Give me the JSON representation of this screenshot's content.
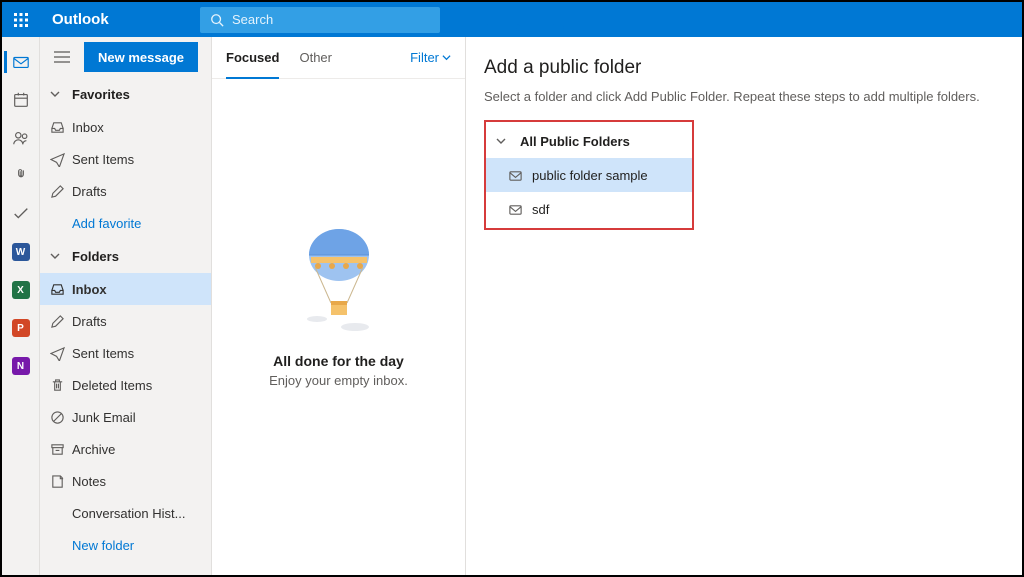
{
  "brand": "Outlook",
  "search": {
    "placeholder": "Search"
  },
  "new_message_label": "New message",
  "sections": {
    "favorites": {
      "label": "Favorites",
      "items": [
        {
          "icon": "tray",
          "label": "Inbox"
        },
        {
          "icon": "send",
          "label": "Sent Items"
        },
        {
          "icon": "pencil",
          "label": "Drafts"
        }
      ],
      "add_label": "Add favorite"
    },
    "folders": {
      "label": "Folders",
      "items": [
        {
          "icon": "tray-full",
          "label": "Inbox",
          "selected": true
        },
        {
          "icon": "pencil",
          "label": "Drafts"
        },
        {
          "icon": "send",
          "label": "Sent Items"
        },
        {
          "icon": "trash",
          "label": "Deleted Items"
        },
        {
          "icon": "block",
          "label": "Junk Email"
        },
        {
          "icon": "archive",
          "label": "Archive"
        },
        {
          "icon": "note",
          "label": "Notes"
        },
        {
          "icon": "",
          "label": "Conversation Hist..."
        }
      ],
      "new_label": "New folder"
    }
  },
  "tabs": {
    "focused": "Focused",
    "other": "Other",
    "filter": "Filter"
  },
  "empty_state": {
    "headline": "All done for the day",
    "sub": "Enjoy your empty inbox."
  },
  "panel": {
    "add_link": "Add Public Folder",
    "title": "Add a public folder",
    "desc": "Select a folder and click Add Public Folder. Repeat these steps to add multiple folders.",
    "tree": {
      "root": "All Public Folders",
      "children": [
        {
          "label": "public folder sample",
          "selected": true
        },
        {
          "label": "sdf",
          "selected": false
        }
      ]
    }
  }
}
